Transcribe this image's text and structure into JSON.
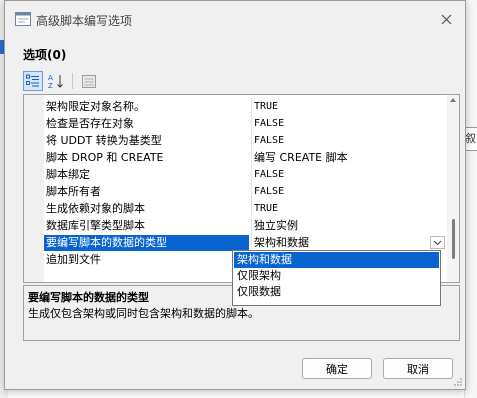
{
  "window": {
    "title": "高级脚本编写选项"
  },
  "section_label": "选项(0)",
  "background": {
    "right_text": "叙"
  },
  "toolbar": {
    "icons": [
      "categorized-icon",
      "sort-alpha-icon",
      "property-pages-icon"
    ]
  },
  "properties": [
    {
      "name": "架构限定对象名称。",
      "value": "TRUE",
      "mono": true
    },
    {
      "name": "检查是否存在对象",
      "value": "FALSE",
      "mono": true
    },
    {
      "name": "将 UDDT 转换为基类型",
      "value": "FALSE",
      "mono": true
    },
    {
      "name": "脚本 DROP 和 CREATE",
      "value": "编写 CREATE 脚本",
      "mono": false
    },
    {
      "name": "脚本绑定",
      "value": "FALSE",
      "mono": true
    },
    {
      "name": "脚本所有者",
      "value": "FALSE",
      "mono": true
    },
    {
      "name": "生成依赖对象的脚本",
      "value": "TRUE",
      "mono": true
    },
    {
      "name": "数据库引擎类型脚本",
      "value": "独立实例",
      "mono": false
    },
    {
      "name": "要编写脚本的数据的类型",
      "value": "架构和数据",
      "mono": false,
      "selected": true
    },
    {
      "name": "追加到文件",
      "value": "",
      "mono": false
    }
  ],
  "dropdown": {
    "options": [
      "架构和数据",
      "仅限架构",
      "仅限数据"
    ],
    "selected": "架构和数据"
  },
  "description": {
    "title": "要编写脚本的数据的类型",
    "text": "生成仅包含架构或同时包含架构和数据的脚本。"
  },
  "buttons": {
    "ok": "确定",
    "cancel": "取消"
  },
  "colors": {
    "selection": "#0a64d0",
    "dialog_bg": "#f0f0f0"
  }
}
